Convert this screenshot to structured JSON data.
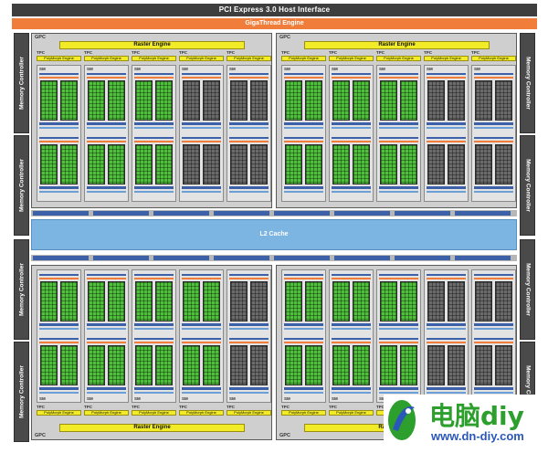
{
  "pci_label": "PCI Express 3.0 Host Interface",
  "gigathread_label": "GigaThread Engine",
  "memory_controller_label": "Memory Controller",
  "gpc_label": "GPC",
  "raster_engine_label": "Raster Engine",
  "tpc_label": "TPC",
  "polymorph_label": "PolyMorph Engine",
  "sm_label": "SM",
  "l2_label": "L2 Cache",
  "watermark": {
    "title": "电脑diy",
    "url": "www.dn-diy.com"
  },
  "colors": {
    "pci": "#3e3e3e",
    "gigathread": "#f07d3a",
    "raster": "#f2ec28",
    "l2": "#7cb4e2",
    "core_active": "#4fc03c",
    "core_disabled": "#6b6b6b",
    "memory_controller": "#4a4a4a",
    "watermark_green": "#2d9f2d",
    "watermark_blue": "#2a58b8"
  }
}
